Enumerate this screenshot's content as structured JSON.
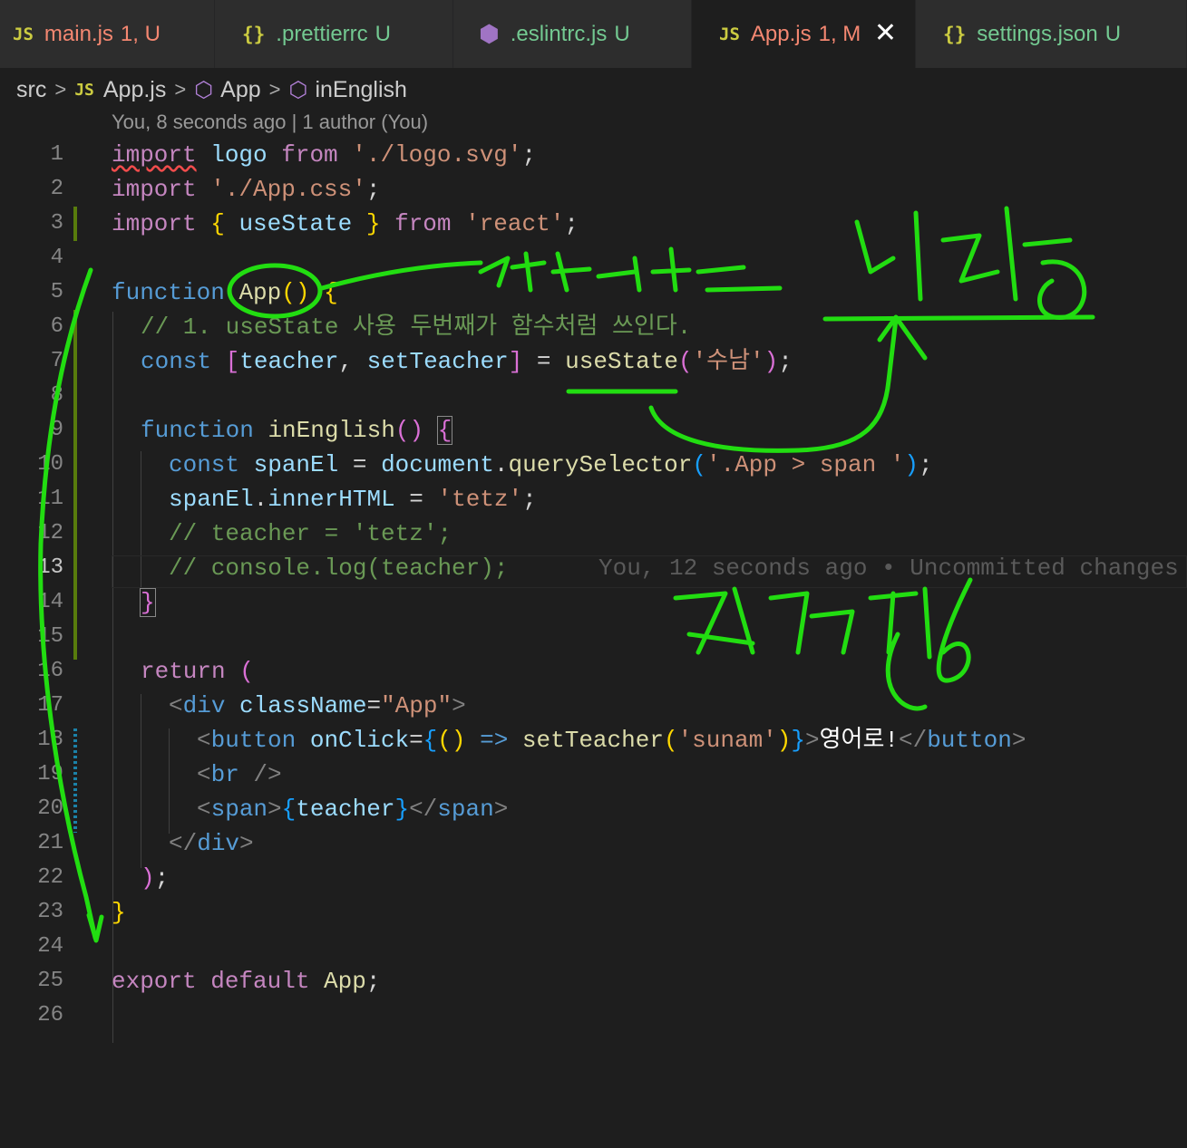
{
  "tabs": [
    {
      "icon": "JS",
      "name": "main.js",
      "status": "1, U",
      "name_color": "#f48771",
      "status_color": "#f48771",
      "active": false
    },
    {
      "icon": "{}",
      "name": ".prettierrc",
      "status": "U",
      "name_color": "#73c991",
      "status_color": "#73c991",
      "active": false
    },
    {
      "icon": "eslint",
      "name": ".eslintrc.js",
      "status": "U",
      "name_color": "#73c991",
      "status_color": "#73c991",
      "active": false
    },
    {
      "icon": "JS",
      "name": "App.js",
      "status": "1, M",
      "name_color": "#f48771",
      "status_color": "#f48771",
      "active": true
    },
    {
      "icon": "{}",
      "name": "settings.json",
      "status": "U",
      "name_color": "#73c991",
      "status_color": "#73c991",
      "active": false
    }
  ],
  "breadcrumb": {
    "folder": "src",
    "file_icon": "JS",
    "file": "App.js",
    "symbol1": "App",
    "symbol2": "inEnglish"
  },
  "blame_header": "You, 8 seconds ago | 1 author (You)",
  "inline_blame": "You, 12 seconds ago • Uncommitted changes",
  "line_numbers": [
    "1",
    "2",
    "3",
    "4",
    "5",
    "6",
    "7",
    "8",
    "9",
    "10",
    "11",
    "12",
    "13",
    "14",
    "15",
    "16",
    "17",
    "18",
    "19",
    "20",
    "21",
    "22",
    "23",
    "24",
    "25",
    "26"
  ],
  "code": {
    "l1": [
      "import",
      " logo ",
      "from",
      " './logo.svg'",
      ";"
    ],
    "l2": [
      "import",
      " './App.css'",
      ";"
    ],
    "l3": [
      "import",
      " ",
      "{",
      " useState ",
      "}",
      " from",
      " 'react'",
      ";"
    ],
    "l5": [
      "function",
      " ",
      "App",
      "(",
      ")",
      " ",
      "{"
    ],
    "l6": "// 1. useState 사용 두번째가 함수처럼 쓰인다.",
    "l7": [
      "const",
      " [",
      "teacher",
      ", ",
      "setTeacher",
      "]",
      " = ",
      "useState",
      "(",
      "'수남'",
      ")",
      ";"
    ],
    "l9": [
      "function",
      " ",
      "inEnglish",
      "(",
      ")",
      " ",
      "{"
    ],
    "l10": [
      "const",
      " ",
      "spanEl",
      " = ",
      "document",
      ".",
      "querySelector",
      "(",
      "'.App > span '",
      ")",
      ";"
    ],
    "l11": [
      "spanEl",
      ".",
      "innerHTML",
      " = ",
      "'tetz'",
      ";"
    ],
    "l12": "// teacher = 'tetz';",
    "l13": "// console.log(teacher);",
    "l14": "}",
    "l16": [
      "return",
      " ",
      "("
    ],
    "l17": [
      "<",
      "div",
      " ",
      "className",
      "=",
      "\"App\"",
      ">"
    ],
    "l18": [
      "<",
      "button",
      " ",
      "onClick",
      "=",
      "{",
      "(",
      ")",
      " => ",
      "setTeacher",
      "(",
      "'sunam'",
      ")",
      "}",
      ">",
      "영어로!",
      "</",
      "button",
      ">"
    ],
    "l19": [
      "<",
      "br",
      " />"
    ],
    "l20": [
      "<",
      "span",
      ">",
      "{",
      "teacher",
      "}",
      "</",
      "span",
      ">"
    ],
    "l21": [
      "</",
      "div",
      ">"
    ],
    "l22": [
      ")",
      ";"
    ],
    "l23": "}",
    "l25": [
      "export",
      " default",
      " App",
      ";"
    ]
  },
  "annotation_color": "#22dd11"
}
